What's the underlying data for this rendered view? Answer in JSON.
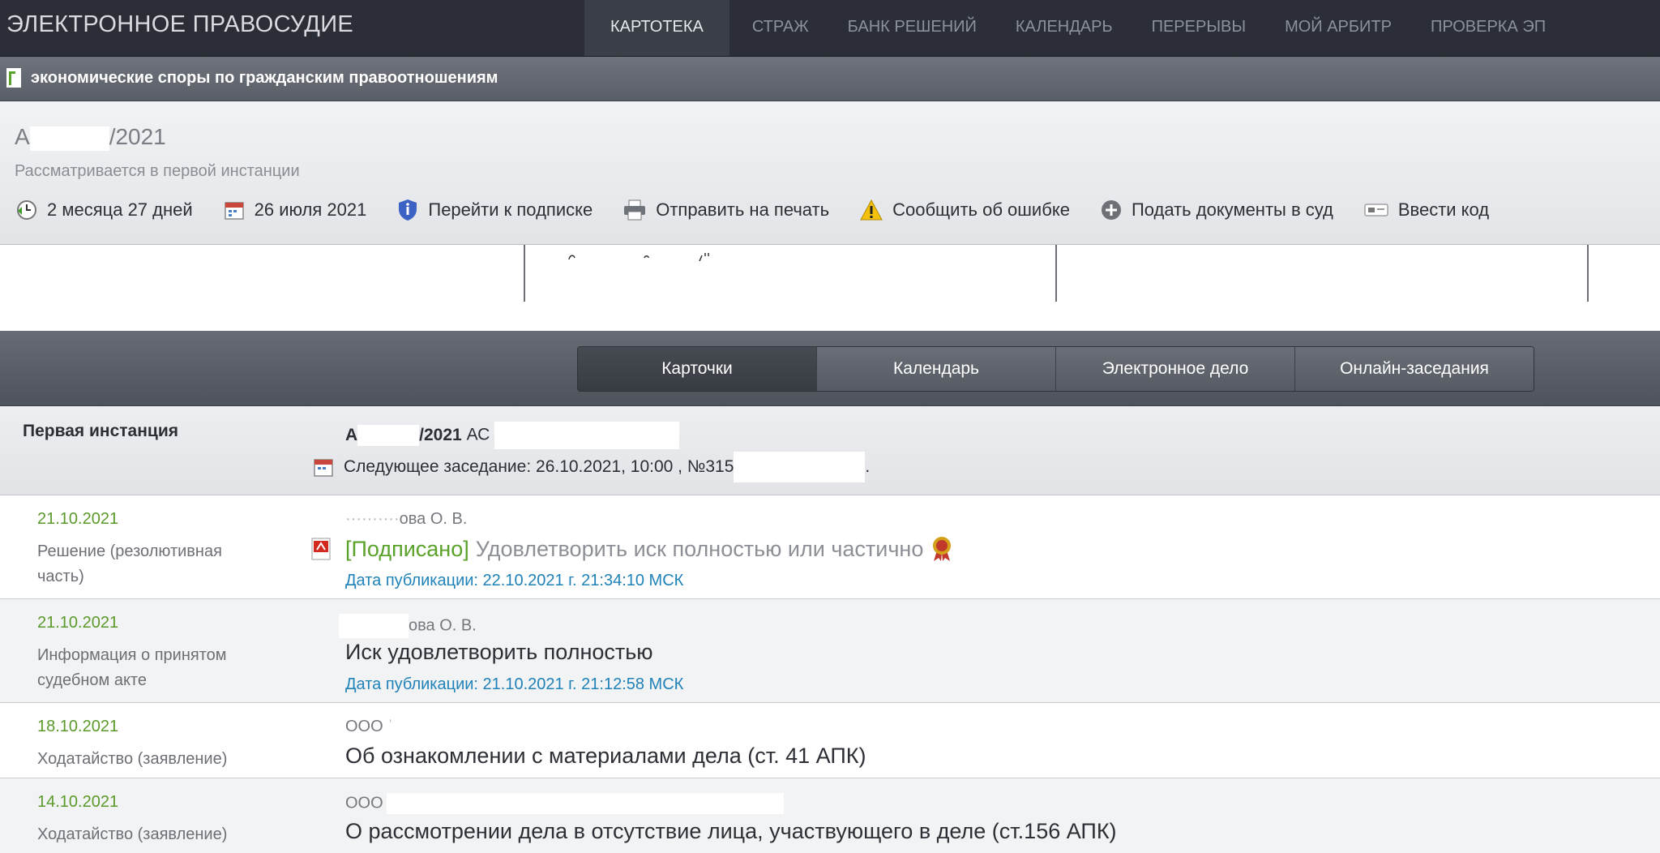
{
  "header": {
    "logo": "ЭЛЕКТРОННОЕ ПРАВОСУДИЕ",
    "nav": [
      "КАРТОТЕКА",
      "СТРАЖ",
      "БАНК РЕШЕНИЙ",
      "КАЛЕНДАРЬ",
      "ПЕРЕРЫВЫ",
      "МОЙ АРБИТР",
      "ПРОВЕРКА ЭП"
    ],
    "active_nav": "КАРТОТЕКА"
  },
  "category": {
    "label": "экономические споры по гражданским правоотношениям"
  },
  "case": {
    "number_prefix": "А",
    "number_suffix": "/2021",
    "status": "Рассматривается в первой инстанции",
    "actions": [
      {
        "icon": "clock-icon",
        "label": "2 месяца 27 дней"
      },
      {
        "icon": "calendar-icon",
        "label": "26 июля 2021"
      },
      {
        "icon": "shield-icon",
        "label": "Перейти к подписке"
      },
      {
        "icon": "printer-icon",
        "label": "Отправить на печать"
      },
      {
        "icon": "warning-icon",
        "label": "Сообщить об ошибке"
      },
      {
        "icon": "plus-circle-icon",
        "label": "Подать документы в суд"
      },
      {
        "icon": "keycard-icon",
        "label": "Ввести код"
      }
    ]
  },
  "tabs": [
    "Карточки",
    "Календарь",
    "Электронное дело",
    "Онлайн-заседания"
  ],
  "instance": {
    "title": "Первая инстанция",
    "case_prefix": "А",
    "case_suffix": "/2021",
    "court_prefix": "АС",
    "next_session": "Следующее заседание: 26.10.2021, 10:00 , №315",
    "next_session_end": "."
  },
  "events": [
    {
      "date": "21.10.2021",
      "type": "Решение (резолютивная часть)",
      "author": "ова О. В.",
      "signed_label": "[Подписано]",
      "document": "Удовлетворить иск полностью или частично",
      "publication": "Дата публикации: 22.10.2021 г. 21:34:10 МСК"
    },
    {
      "date": "21.10.2021",
      "type": "Информация о принятом судебном акте",
      "author": "ова О. В.",
      "document": "Иск удовлетворить полностью",
      "publication": "Дата публикации: 21.10.2021 г. 21:12:58 МСК"
    },
    {
      "date": "18.10.2021",
      "type": "Ходатайство (заявление)",
      "author": "ООО",
      "document": "Об ознакомлении с материалами дела (ст. 41 АПК)"
    },
    {
      "date": "14.10.2021",
      "type": "Ходатайство (заявление)",
      "author": "ООО",
      "document": "О рассмотрении дела в отсутствие лица, участвующего в деле (ст.156 АПК)"
    }
  ],
  "colors": {
    "topbar": "#2b2e36",
    "date_green": "#5b9a2a",
    "publication_blue": "#1f82b8",
    "signed_green": "#5aa22a"
  }
}
